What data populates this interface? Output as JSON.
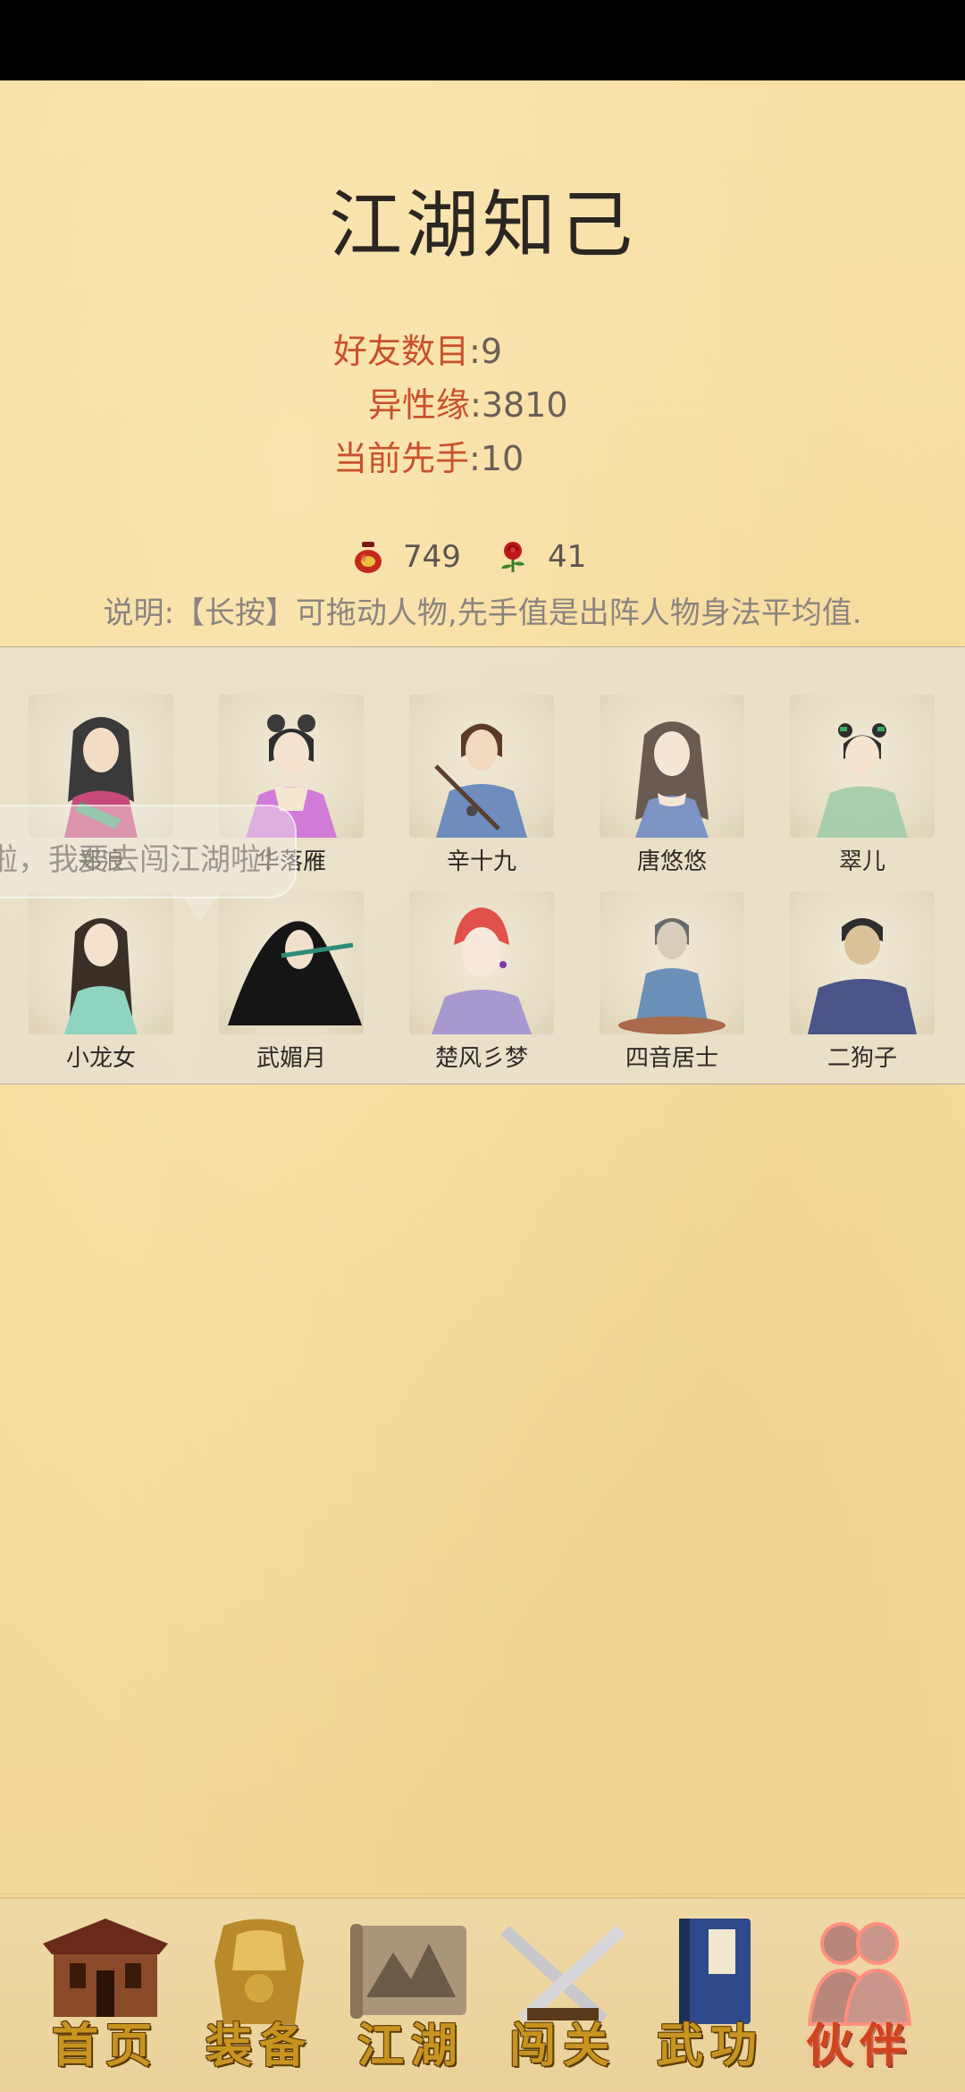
{
  "page": {
    "title": "江湖知己",
    "stats": [
      {
        "label": "好友数目",
        "value": "9"
      },
      {
        "label": "异性缘",
        "value": "3810"
      },
      {
        "label": "当前先手",
        "value": "10"
      }
    ],
    "resources": [
      {
        "icon": "wine-jar-icon",
        "value": "749"
      },
      {
        "icon": "rose-icon",
        "value": "41"
      }
    ],
    "note": "说明:【长按】可拖动人物,先手值是出阵人物身法平均值.",
    "speech_bubble": "啦，我要去闯江湖啦！"
  },
  "characters": [
    {
      "name": "郑浪"
    },
    {
      "name": "华落雁"
    },
    {
      "name": "辛十九"
    },
    {
      "name": "唐悠悠"
    },
    {
      "name": "翠儿"
    },
    {
      "name": "小龙女"
    },
    {
      "name": "武媚月"
    },
    {
      "name": "楚风彡梦"
    },
    {
      "name": "四音居士"
    },
    {
      "name": "二狗子"
    }
  ],
  "nav": [
    {
      "label": "首页",
      "icon": "house-icon",
      "active": false
    },
    {
      "label": "装备",
      "icon": "armor-icon",
      "active": false
    },
    {
      "label": "江湖",
      "icon": "scroll-map-icon",
      "active": false
    },
    {
      "label": "闯关",
      "icon": "crossed-swords-icon",
      "active": false
    },
    {
      "label": "武功",
      "icon": "martial-book-icon",
      "active": false
    },
    {
      "label": "伙伴",
      "icon": "companions-icon",
      "active": true
    }
  ],
  "colors": {
    "background": "#f5dc9e",
    "stat_label": "#c9502e",
    "nav_text": "#c89420",
    "nav_active": "#d0441e"
  }
}
